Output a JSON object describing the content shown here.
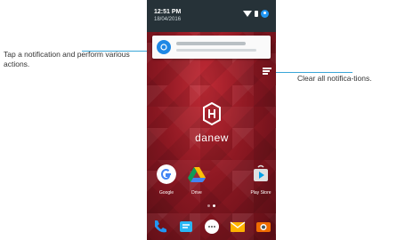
{
  "callouts": {
    "notification": "Tap a notification and perform various actions.",
    "clear_all": "Clear all notifica-tions."
  },
  "status_bar": {
    "time": "12:51 PM",
    "date": "18/04/2016"
  },
  "home": {
    "brand": "danew",
    "apps": [
      {
        "label": "Google",
        "icon": "google-icon"
      },
      {
        "label": "Drive",
        "icon": "drive-icon"
      },
      {
        "label": "Play Store",
        "icon": "play-store-icon"
      }
    ],
    "dock": [
      "phone-icon",
      "messages-icon",
      "app-drawer-icon",
      "email-icon",
      "camera-icon"
    ]
  },
  "colors": {
    "accent": "#3aa6d8",
    "wallpaper": "#8d1822",
    "shade": "#263238"
  }
}
